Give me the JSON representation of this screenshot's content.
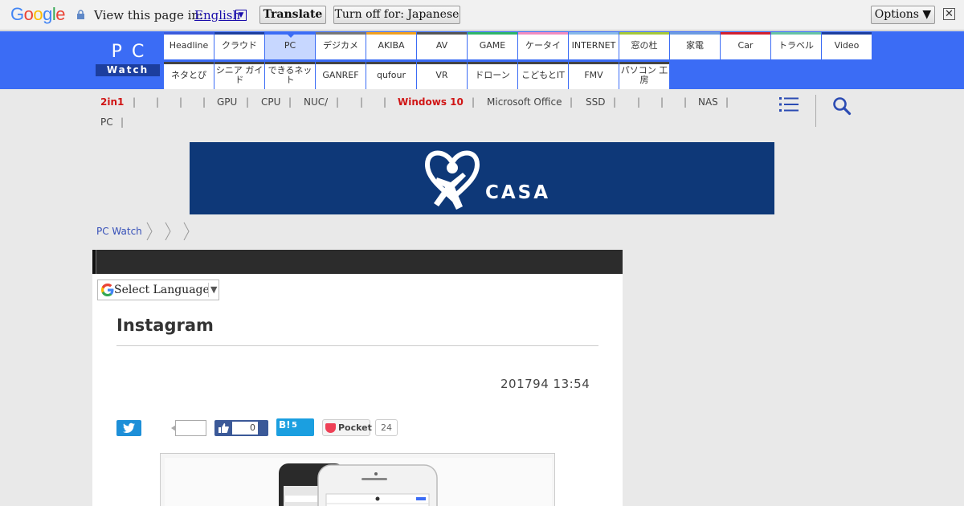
{
  "translate_bar": {
    "google_logo": "Google",
    "prompt": "View this page in:",
    "language": "English",
    "translate_label": "Translate",
    "turn_off_label": "Turn off for: Japanese",
    "options_label": "Options ▼",
    "close_label": "✕"
  },
  "site": {
    "logo_top": "PC",
    "logo_bottom": "Watch",
    "nav_row1": [
      {
        "label": "Headline",
        "color": "#3b5bdb"
      },
      {
        "label": "クラウド",
        "color": "#1c3e9e"
      },
      {
        "label": "PC",
        "color": "#3b6cf5"
      },
      {
        "label": "デジカメ",
        "color": "#777777"
      },
      {
        "label": "AKIBA",
        "color": "#f0a020"
      },
      {
        "label": "AV",
        "color": "#555555"
      },
      {
        "label": "GAME",
        "color": "#2fb36a"
      },
      {
        "label": "ケータイ",
        "color": "#f08cc0"
      },
      {
        "label": "INTERNET",
        "color": "#86b8e8"
      },
      {
        "label": "窓の杜",
        "color": "#a5c83a"
      },
      {
        "label": "家電",
        "color": "#6c9be0"
      },
      {
        "label": "Car",
        "color": "#d02030"
      },
      {
        "label": "トラベル",
        "color": "#66c2a5"
      },
      {
        "label": "Video",
        "color": "#1c3e9e"
      }
    ],
    "nav_row2": [
      {
        "label": "ネタとぴ",
        "color": "#444444"
      },
      {
        "label": "シニア ガイド",
        "color": "#444444"
      },
      {
        "label": "できるネット",
        "color": "#444444"
      },
      {
        "label": "GANREF",
        "color": "#444444"
      },
      {
        "label": "qufour",
        "color": "#444444"
      },
      {
        "label": "VR",
        "color": "#444444"
      },
      {
        "label": "ドローン",
        "color": "#444444"
      },
      {
        "label": "こどもとIT",
        "color": "#444444"
      },
      {
        "label": "FMV",
        "color": "#444444"
      },
      {
        "label": "パソコン 工房",
        "color": "#444444"
      }
    ]
  },
  "keywords": [
    "2in1",
    "GPU",
    "CPU",
    "NUC/",
    "Windows 10",
    "Microsoft Office",
    "SSD",
    "NAS",
    "PC"
  ],
  "banner": {
    "text": "CASA"
  },
  "breadcrumb": {
    "home": "PC Watch"
  },
  "article": {
    "language_select": "Select Language",
    "title": "Instagram",
    "date": "201794 13:54",
    "facebook_count": "0",
    "hatena_label": "B!",
    "hatena_count": "5",
    "pocket_label": "Pocket",
    "pocket_count": "24"
  }
}
